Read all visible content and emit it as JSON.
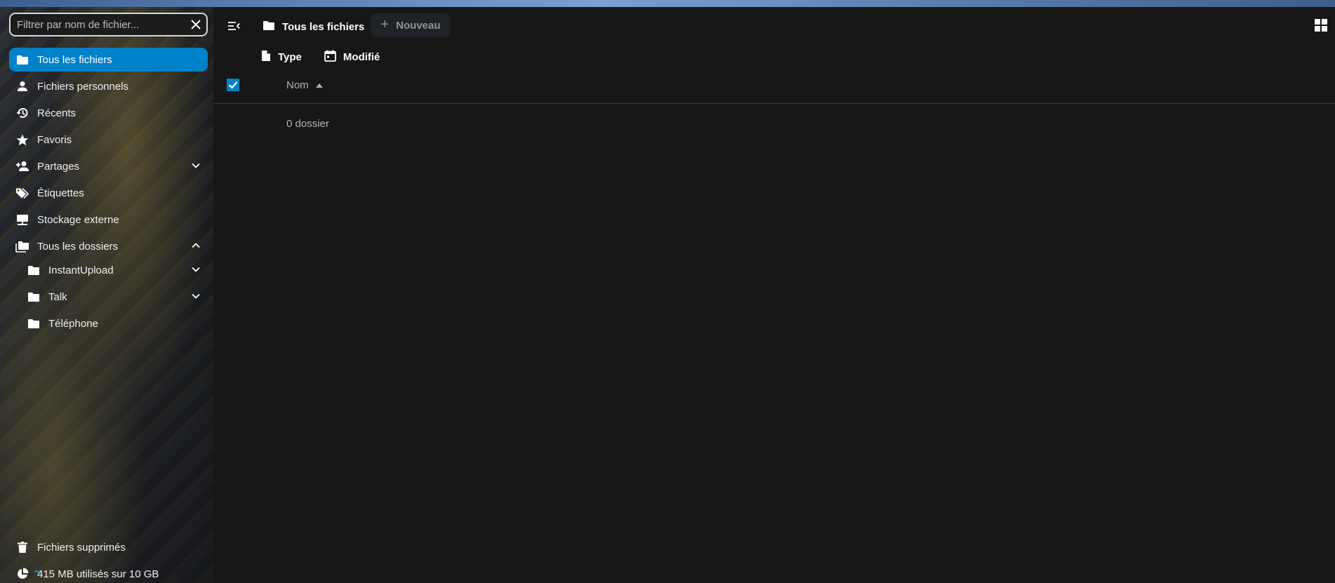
{
  "filter": {
    "placeholder": "Filtrer par nom de fichier..."
  },
  "sidebar": {
    "items": [
      {
        "label": "Tous les fichiers",
        "icon": "folder-icon"
      },
      {
        "label": "Fichiers personnels",
        "icon": "user-icon"
      },
      {
        "label": "Récents",
        "icon": "history-icon"
      },
      {
        "label": "Favoris",
        "icon": "star-icon"
      },
      {
        "label": "Partages",
        "icon": "share-icon"
      },
      {
        "label": "Étiquettes",
        "icon": "tag-icon"
      },
      {
        "label": "Stockage externe",
        "icon": "external-storage-icon"
      },
      {
        "label": "Tous les dossiers",
        "icon": "folder-multiple-icon"
      }
    ],
    "folders": [
      {
        "label": "InstantUpload"
      },
      {
        "label": "Talk"
      },
      {
        "label": "Téléphone"
      }
    ],
    "trash": {
      "label": "Fichiers supprimés"
    },
    "quota": {
      "label": "415 MB utilisés sur 10 GB",
      "used_fraction": 0.0415
    }
  },
  "header": {
    "breadcrumb": "Tous les fichiers",
    "new_button": "Nouveau"
  },
  "filters": {
    "type": "Type",
    "modified": "Modifié"
  },
  "table": {
    "column_name": "Nom",
    "summary": "0 dossier"
  },
  "colors": {
    "accent": "#0082c9",
    "background": "#171717"
  }
}
